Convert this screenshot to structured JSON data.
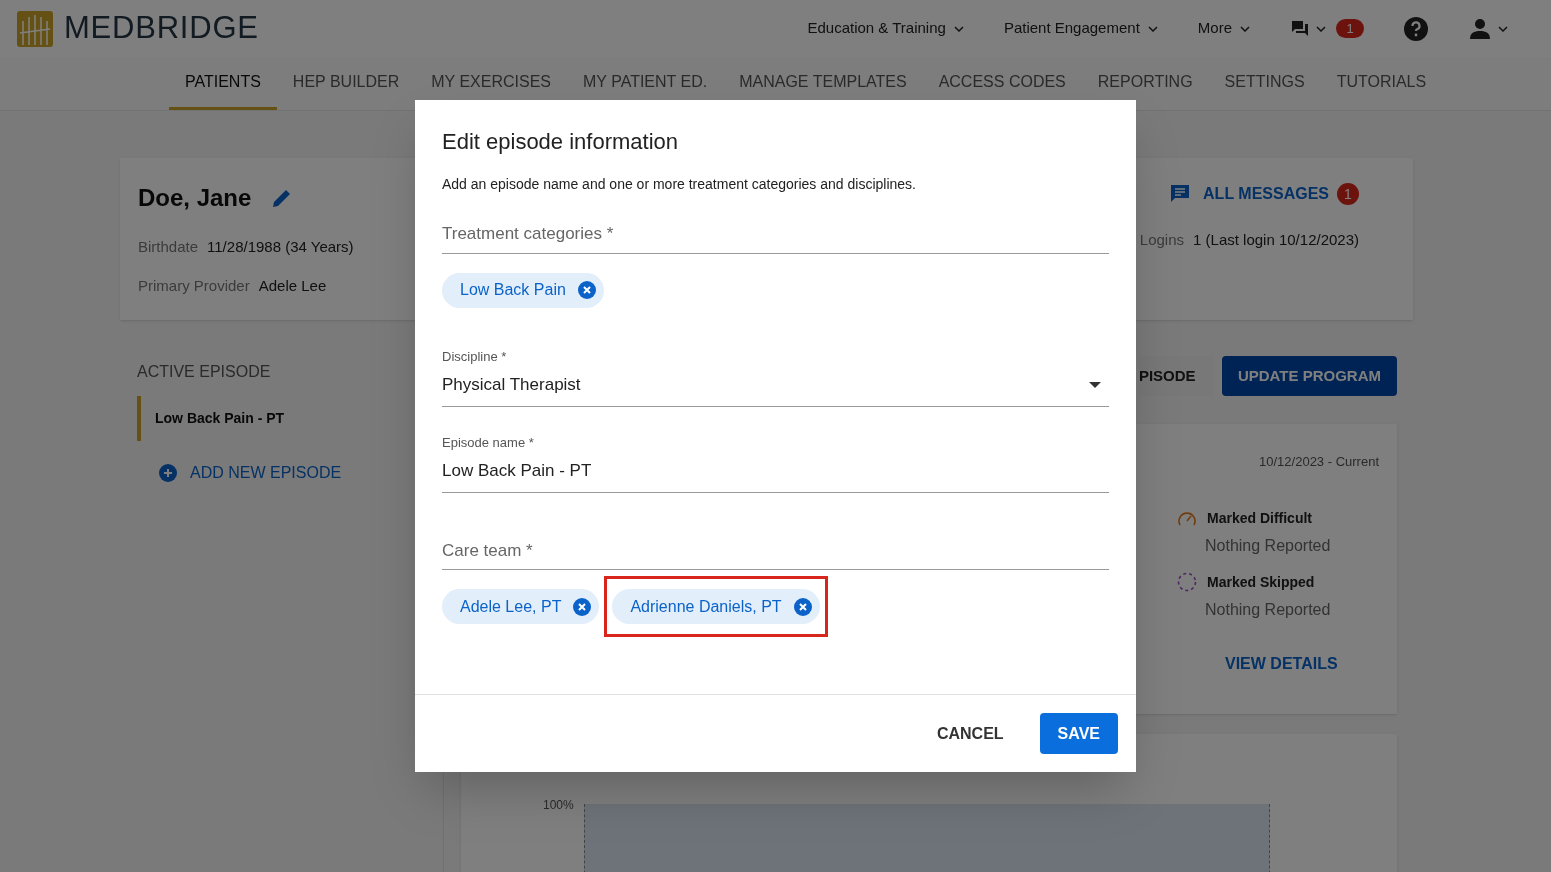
{
  "header": {
    "logo": "MEDBRIDGE",
    "menus": [
      {
        "label": "Education & Training"
      },
      {
        "label": "Patient Engagement"
      },
      {
        "label": "More"
      }
    ],
    "message_badge": "1"
  },
  "tabs": [
    {
      "label": "PATIENTS",
      "selected": true
    },
    {
      "label": "HEP BUILDER",
      "selected": false
    },
    {
      "label": "MY EXERCISES",
      "selected": false
    },
    {
      "label": "MY PATIENT ED.",
      "selected": false
    },
    {
      "label": "MANAGE TEMPLATES",
      "selected": false
    },
    {
      "label": "ACCESS CODES",
      "selected": false
    },
    {
      "label": "REPORTING",
      "selected": false
    },
    {
      "label": "SETTINGS",
      "selected": false
    },
    {
      "label": "TUTORIALS",
      "selected": false
    }
  ],
  "patient": {
    "name": "Doe, Jane",
    "details": [
      {
        "label": "Birthdate",
        "value": "11/28/1988 (34 Years)"
      },
      {
        "label": "Primary Provider",
        "value": "Adele Lee"
      }
    ],
    "messages_link": "ALL MESSAGES",
    "messages_badge": "1",
    "logins_label": "Logins",
    "logins_value": "1 (Last login 10/12/2023)"
  },
  "sidebar": {
    "heading": "ACTIVE EPISODE",
    "episodes": [
      {
        "label": "Low Back Pain - PT",
        "selected": true
      }
    ],
    "add_link": "ADD NEW EPISODE"
  },
  "actions": [
    {
      "label": "PISODE",
      "kind": "secondary"
    },
    {
      "label": "UPDATE PROGRAM",
      "kind": "primary"
    }
  ],
  "summary": {
    "date_range": "10/12/2023 - Current",
    "items": [
      {
        "kind": "difficult",
        "title": "Marked Difficult",
        "value": "Nothing Reported"
      },
      {
        "kind": "skipped",
        "title": "Marked Skipped",
        "value": "Nothing Reported"
      }
    ],
    "link": "VIEW DETAILS"
  },
  "chart": {
    "y_label": "100%"
  },
  "dialog": {
    "title": "Edit episode information",
    "subtitle": "Add an episode name and one or more treatment categories and disciplines.",
    "fields": [
      {
        "kind": "chips",
        "placeholder": "Treatment categories *",
        "chips": [
          {
            "label": "Low Back Pain",
            "highlighted": false
          }
        ]
      },
      {
        "kind": "select",
        "label": "Discipline *",
        "value": "Physical Therapist"
      },
      {
        "kind": "text",
        "label": "Episode name *",
        "value": "Low Back Pain - PT"
      },
      {
        "kind": "chips",
        "placeholder": "Care team *",
        "chips": [
          {
            "label": "Adele Lee, PT",
            "highlighted": false
          },
          {
            "label": "Adrienne Daniels, PT",
            "highlighted": true
          }
        ]
      }
    ],
    "buttons": [
      {
        "label": "CANCEL",
        "kind": "text"
      },
      {
        "label": "SAVE",
        "kind": "primary"
      }
    ]
  }
}
